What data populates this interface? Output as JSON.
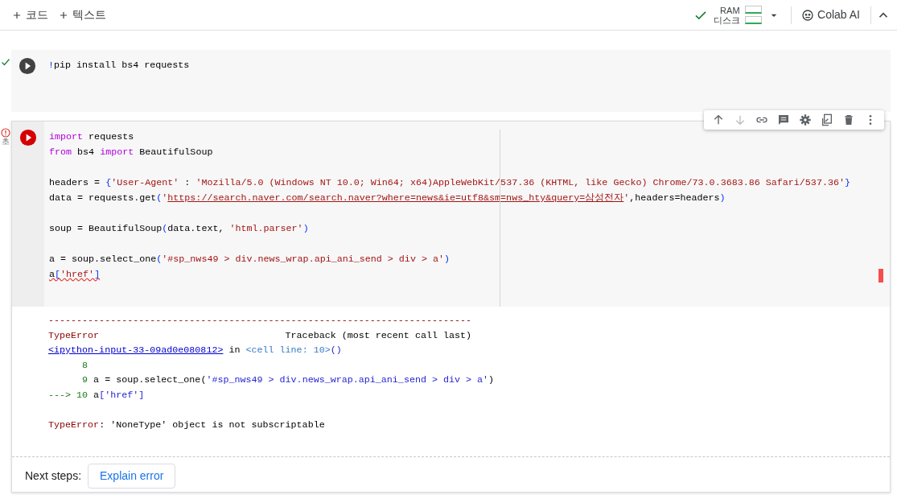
{
  "top_bar": {
    "add_buttons": [
      {
        "label": "코드"
      },
      {
        "label": "텍스트"
      }
    ],
    "connected": true,
    "ram_label": "RAM",
    "disk_label": "디스크",
    "ai_button": "Colab AI"
  },
  "cells": [
    {
      "failed": false,
      "lines": [
        {
          "kind": "code",
          "flagged": false,
          "tokens": [
            {
              "kind": "punc",
              "t": "!"
            },
            {
              "kind": "plain",
              "t": "pip install bs4 requests"
            }
          ]
        }
      ]
    },
    {
      "failed": true,
      "time": "초",
      "toolbar": [
        {
          "disabled": false
        },
        {
          "disabled": true
        },
        {
          "disabled": false
        },
        {
          "disabled": false
        },
        {
          "disabled": false
        },
        {
          "disabled": false
        },
        {
          "disabled": false
        },
        {
          "disabled": false
        }
      ],
      "lines": [
        {
          "kind": "code",
          "flagged": false,
          "tokens": [
            {
              "kind": "kw",
              "t": "import"
            },
            {
              "kind": "plain",
              "t": " requests"
            }
          ]
        },
        {
          "kind": "code",
          "flagged": false,
          "tokens": [
            {
              "kind": "kw",
              "t": "from"
            },
            {
              "kind": "plain",
              "t": " bs4 "
            },
            {
              "kind": "kw",
              "t": "import"
            },
            {
              "kind": "plain",
              "t": " BeautifulSoup"
            }
          ]
        },
        {
          "kind": "blank"
        },
        {
          "kind": "code",
          "flagged": false,
          "tokens": [
            {
              "kind": "plain",
              "t": "headers = "
            },
            {
              "kind": "punc",
              "t": "{"
            },
            {
              "kind": "str",
              "t": "'User-Agent'"
            },
            {
              "kind": "plain",
              "t": " : "
            },
            {
              "kind": "str",
              "t": "'Mozilla/5.0 (Windows NT 10.0; Win64; x64)AppleWebKit/537.36 (KHTML, like Gecko) Chrome/73.0.3683.86 Safari/537.36'"
            },
            {
              "kind": "punc",
              "t": "}"
            }
          ]
        },
        {
          "kind": "code",
          "flagged": false,
          "tokens": [
            {
              "kind": "plain",
              "t": "data = requests.get"
            },
            {
              "kind": "punc",
              "t": "("
            },
            {
              "kind": "str",
              "t": "'"
            },
            {
              "kind": "url",
              "t": "https://search.naver.com/search.naver?where=news&ie=utf8&sm=nws_hty&query=삼성전자"
            },
            {
              "kind": "str",
              "t": "'"
            },
            {
              "kind": "plain",
              "t": ",headers=headers"
            },
            {
              "kind": "punc",
              "t": ")"
            }
          ]
        },
        {
          "kind": "blank"
        },
        {
          "kind": "code",
          "flagged": false,
          "tokens": [
            {
              "kind": "plain",
              "t": "soup = BeautifulSoup"
            },
            {
              "kind": "punc",
              "t": "("
            },
            {
              "kind": "plain",
              "t": "data.text, "
            },
            {
              "kind": "str",
              "t": "'html.parser'"
            },
            {
              "kind": "punc",
              "t": ")"
            }
          ]
        },
        {
          "kind": "blank"
        },
        {
          "kind": "code",
          "flagged": false,
          "tokens": [
            {
              "kind": "plain",
              "t": "a = soup.select_one"
            },
            {
              "kind": "punc",
              "t": "("
            },
            {
              "kind": "str",
              "t": "'#sp_nws49 > div.news_wrap.api_ani_send > div > a'"
            },
            {
              "kind": "punc",
              "t": ")"
            }
          ]
        },
        {
          "kind": "code",
          "flagged": true,
          "tokens": [
            {
              "kind": "plain",
              "t": "a"
            },
            {
              "kind": "punc",
              "t": "["
            },
            {
              "kind": "str",
              "t": "'href'"
            },
            {
              "kind": "punc",
              "t": "]"
            }
          ]
        }
      ],
      "output": [
        {
          "kind": "code",
          "tokens": [
            {
              "kind": "err",
              "t": "---------------------------------------------------------------------------"
            }
          ]
        },
        {
          "kind": "code",
          "tokens": [
            {
              "kind": "err",
              "t": "TypeError"
            },
            {
              "kind": "plain",
              "t": "                                 Traceback (most recent call last)"
            }
          ]
        },
        {
          "kind": "code",
          "tokens": [
            {
              "kind": "link",
              "t": "<ipython-input-33-09ad0e080812>"
            },
            {
              "kind": "plain",
              "t": " in "
            },
            {
              "kind": "ref",
              "t": "<cell line: 10>"
            },
            {
              "kind": "blue",
              "t": "()"
            }
          ]
        },
        {
          "kind": "code",
          "tokens": [
            {
              "kind": "num",
              "t": "      8"
            }
          ]
        },
        {
          "kind": "code",
          "tokens": [
            {
              "kind": "num",
              "t": "      9"
            },
            {
              "kind": "plain",
              "t": " a = soup.select_one("
            },
            {
              "kind": "blue",
              "t": "'#sp_nws49 > div.news_wrap.api_ani_send > div > a'"
            },
            {
              "kind": "plain",
              "t": ")"
            }
          ]
        },
        {
          "kind": "code",
          "tokens": [
            {
              "kind": "num",
              "t": "---> 10"
            },
            {
              "kind": "plain",
              "t": " a"
            },
            {
              "kind": "blue",
              "t": "['href']"
            }
          ]
        },
        {
          "kind": "blank"
        },
        {
          "kind": "code",
          "tokens": [
            {
              "kind": "err",
              "t": "TypeError"
            },
            {
              "kind": "plain",
              "t": ": 'NoneType' object is not subscriptable"
            }
          ]
        }
      ],
      "next_steps": {
        "label": "Next steps:",
        "button": "Explain error"
      }
    }
  ]
}
